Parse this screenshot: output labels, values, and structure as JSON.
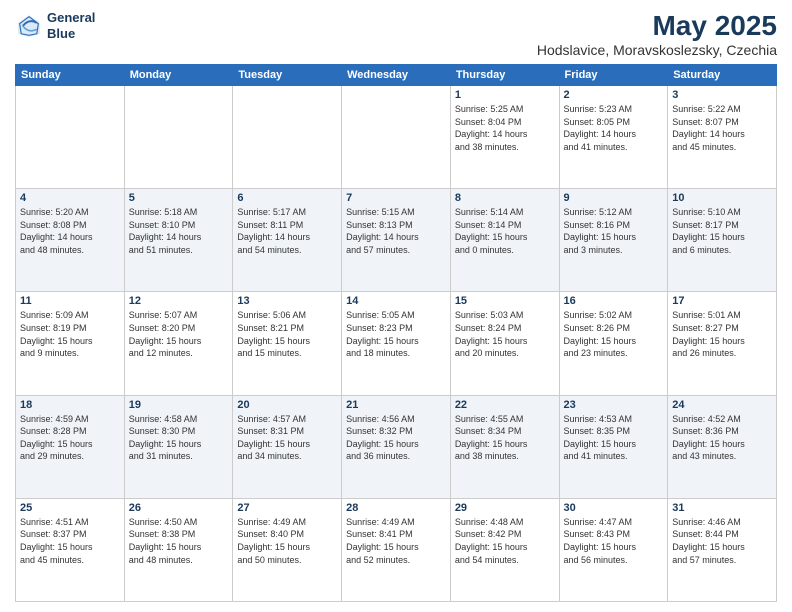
{
  "header": {
    "logo_line1": "General",
    "logo_line2": "Blue",
    "title": "May 2025",
    "subtitle": "Hodslavice, Moravskoslezsky, Czechia"
  },
  "weekdays": [
    "Sunday",
    "Monday",
    "Tuesday",
    "Wednesday",
    "Thursday",
    "Friday",
    "Saturday"
  ],
  "weeks": [
    [
      {
        "day": "",
        "lines": []
      },
      {
        "day": "",
        "lines": []
      },
      {
        "day": "",
        "lines": []
      },
      {
        "day": "",
        "lines": []
      },
      {
        "day": "1",
        "lines": [
          "Sunrise: 5:25 AM",
          "Sunset: 8:04 PM",
          "Daylight: 14 hours",
          "and 38 minutes."
        ]
      },
      {
        "day": "2",
        "lines": [
          "Sunrise: 5:23 AM",
          "Sunset: 8:05 PM",
          "Daylight: 14 hours",
          "and 41 minutes."
        ]
      },
      {
        "day": "3",
        "lines": [
          "Sunrise: 5:22 AM",
          "Sunset: 8:07 PM",
          "Daylight: 14 hours",
          "and 45 minutes."
        ]
      }
    ],
    [
      {
        "day": "4",
        "lines": [
          "Sunrise: 5:20 AM",
          "Sunset: 8:08 PM",
          "Daylight: 14 hours",
          "and 48 minutes."
        ]
      },
      {
        "day": "5",
        "lines": [
          "Sunrise: 5:18 AM",
          "Sunset: 8:10 PM",
          "Daylight: 14 hours",
          "and 51 minutes."
        ]
      },
      {
        "day": "6",
        "lines": [
          "Sunrise: 5:17 AM",
          "Sunset: 8:11 PM",
          "Daylight: 14 hours",
          "and 54 minutes."
        ]
      },
      {
        "day": "7",
        "lines": [
          "Sunrise: 5:15 AM",
          "Sunset: 8:13 PM",
          "Daylight: 14 hours",
          "and 57 minutes."
        ]
      },
      {
        "day": "8",
        "lines": [
          "Sunrise: 5:14 AM",
          "Sunset: 8:14 PM",
          "Daylight: 15 hours",
          "and 0 minutes."
        ]
      },
      {
        "day": "9",
        "lines": [
          "Sunrise: 5:12 AM",
          "Sunset: 8:16 PM",
          "Daylight: 15 hours",
          "and 3 minutes."
        ]
      },
      {
        "day": "10",
        "lines": [
          "Sunrise: 5:10 AM",
          "Sunset: 8:17 PM",
          "Daylight: 15 hours",
          "and 6 minutes."
        ]
      }
    ],
    [
      {
        "day": "11",
        "lines": [
          "Sunrise: 5:09 AM",
          "Sunset: 8:19 PM",
          "Daylight: 15 hours",
          "and 9 minutes."
        ]
      },
      {
        "day": "12",
        "lines": [
          "Sunrise: 5:07 AM",
          "Sunset: 8:20 PM",
          "Daylight: 15 hours",
          "and 12 minutes."
        ]
      },
      {
        "day": "13",
        "lines": [
          "Sunrise: 5:06 AM",
          "Sunset: 8:21 PM",
          "Daylight: 15 hours",
          "and 15 minutes."
        ]
      },
      {
        "day": "14",
        "lines": [
          "Sunrise: 5:05 AM",
          "Sunset: 8:23 PM",
          "Daylight: 15 hours",
          "and 18 minutes."
        ]
      },
      {
        "day": "15",
        "lines": [
          "Sunrise: 5:03 AM",
          "Sunset: 8:24 PM",
          "Daylight: 15 hours",
          "and 20 minutes."
        ]
      },
      {
        "day": "16",
        "lines": [
          "Sunrise: 5:02 AM",
          "Sunset: 8:26 PM",
          "Daylight: 15 hours",
          "and 23 minutes."
        ]
      },
      {
        "day": "17",
        "lines": [
          "Sunrise: 5:01 AM",
          "Sunset: 8:27 PM",
          "Daylight: 15 hours",
          "and 26 minutes."
        ]
      }
    ],
    [
      {
        "day": "18",
        "lines": [
          "Sunrise: 4:59 AM",
          "Sunset: 8:28 PM",
          "Daylight: 15 hours",
          "and 29 minutes."
        ]
      },
      {
        "day": "19",
        "lines": [
          "Sunrise: 4:58 AM",
          "Sunset: 8:30 PM",
          "Daylight: 15 hours",
          "and 31 minutes."
        ]
      },
      {
        "day": "20",
        "lines": [
          "Sunrise: 4:57 AM",
          "Sunset: 8:31 PM",
          "Daylight: 15 hours",
          "and 34 minutes."
        ]
      },
      {
        "day": "21",
        "lines": [
          "Sunrise: 4:56 AM",
          "Sunset: 8:32 PM",
          "Daylight: 15 hours",
          "and 36 minutes."
        ]
      },
      {
        "day": "22",
        "lines": [
          "Sunrise: 4:55 AM",
          "Sunset: 8:34 PM",
          "Daylight: 15 hours",
          "and 38 minutes."
        ]
      },
      {
        "day": "23",
        "lines": [
          "Sunrise: 4:53 AM",
          "Sunset: 8:35 PM",
          "Daylight: 15 hours",
          "and 41 minutes."
        ]
      },
      {
        "day": "24",
        "lines": [
          "Sunrise: 4:52 AM",
          "Sunset: 8:36 PM",
          "Daylight: 15 hours",
          "and 43 minutes."
        ]
      }
    ],
    [
      {
        "day": "25",
        "lines": [
          "Sunrise: 4:51 AM",
          "Sunset: 8:37 PM",
          "Daylight: 15 hours",
          "and 45 minutes."
        ]
      },
      {
        "day": "26",
        "lines": [
          "Sunrise: 4:50 AM",
          "Sunset: 8:38 PM",
          "Daylight: 15 hours",
          "and 48 minutes."
        ]
      },
      {
        "day": "27",
        "lines": [
          "Sunrise: 4:49 AM",
          "Sunset: 8:40 PM",
          "Daylight: 15 hours",
          "and 50 minutes."
        ]
      },
      {
        "day": "28",
        "lines": [
          "Sunrise: 4:49 AM",
          "Sunset: 8:41 PM",
          "Daylight: 15 hours",
          "and 52 minutes."
        ]
      },
      {
        "day": "29",
        "lines": [
          "Sunrise: 4:48 AM",
          "Sunset: 8:42 PM",
          "Daylight: 15 hours",
          "and 54 minutes."
        ]
      },
      {
        "day": "30",
        "lines": [
          "Sunrise: 4:47 AM",
          "Sunset: 8:43 PM",
          "Daylight: 15 hours",
          "and 56 minutes."
        ]
      },
      {
        "day": "31",
        "lines": [
          "Sunrise: 4:46 AM",
          "Sunset: 8:44 PM",
          "Daylight: 15 hours",
          "and 57 minutes."
        ]
      }
    ]
  ]
}
